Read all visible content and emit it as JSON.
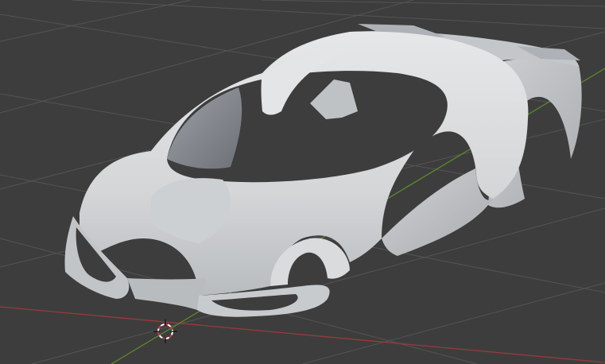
{
  "viewport": {
    "view": "perspective",
    "shading": "solid",
    "background_color": "#3d3d3d",
    "grid_color": "#545454",
    "x_axis_color": "#9b3a3a",
    "y_axis_color": "#5a8a2a"
  },
  "model": {
    "type": "car-body-shell",
    "color": "#d6d8da"
  },
  "cursor": {
    "icon": "3d-cursor-icon"
  }
}
